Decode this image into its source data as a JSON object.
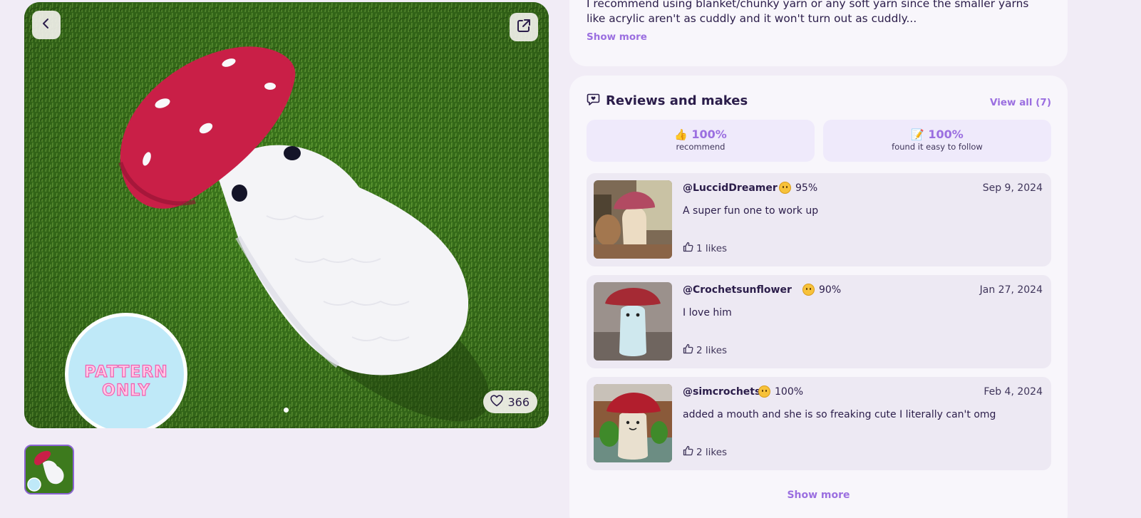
{
  "gallery": {
    "likes_count": "366",
    "badge_line1": "PATTERN",
    "badge_line2": "ONLY",
    "icons": {
      "back": "chevron-left-icon",
      "share": "external-link-icon",
      "likes": "heart-icon"
    },
    "current_slide": 1,
    "slide_count": 1
  },
  "description": {
    "text": "I recommend using blanket/chunky yarn or any soft yarn since the smaller yarns like acrylic aren't as cuddly and it won't turn out as cuddly...",
    "show_more": "Show more"
  },
  "reviews": {
    "title": "Reviews and makes",
    "title_icon": "chat-heart-icon",
    "view_all": "View all (7)",
    "stats": [
      {
        "emoji": "👍",
        "value": "100%",
        "label": "recommend"
      },
      {
        "emoji": "📝",
        "value": "100%",
        "label": "found it easy to follow"
      }
    ],
    "items": [
      {
        "user": "@LuccidDreamer",
        "score": "95%",
        "date": "Sep 9, 2024",
        "text": "A super fun one to work up",
        "likes": "1 likes"
      },
      {
        "user": "@Crochetsunflower",
        "score": "90%",
        "date": "Jan 27, 2024",
        "text": "I love him",
        "likes": "2 likes"
      },
      {
        "user": "@simcrochets",
        "score": "100%",
        "date": "Feb 4, 2024",
        "text": "added a mouth and she is so freaking cute I literally can't omg",
        "likes": "2 likes"
      }
    ],
    "show_more": "Show more"
  },
  "colors": {
    "accent": "#9b6fe0",
    "background": "#f1ecf6",
    "card": "#f8f6fb",
    "mushroom_cap": "#c91f47",
    "grass": "#3f7a1f"
  }
}
